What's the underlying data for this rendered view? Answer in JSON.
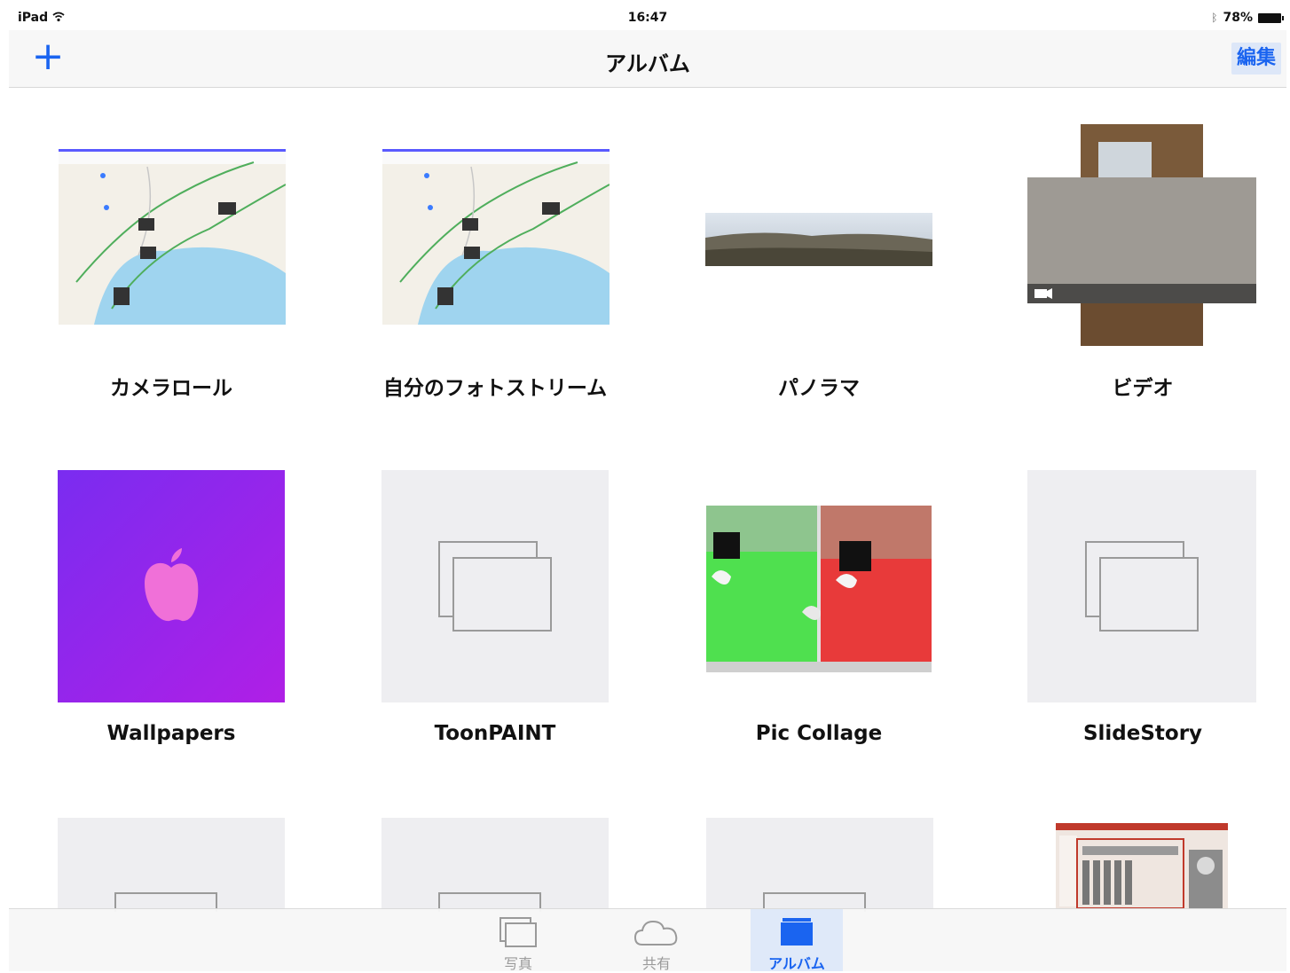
{
  "status": {
    "device": "iPad",
    "time": "16:47",
    "battery": "78%"
  },
  "nav": {
    "add_icon": "+",
    "title": "アルバム",
    "edit_label": "編集"
  },
  "albums": [
    {
      "title": "カメラロール"
    },
    {
      "title": "自分のフォトストリーム"
    },
    {
      "title": "パノラマ"
    },
    {
      "title": "ビデオ"
    },
    {
      "title": "Wallpapers"
    },
    {
      "title": "ToonPAINT"
    },
    {
      "title": "Pic Collage"
    },
    {
      "title": "SlideStory"
    }
  ],
  "tabs": [
    {
      "label": "写真",
      "icon": "photos-icon"
    },
    {
      "label": "共有",
      "icon": "cloud-icon"
    },
    {
      "label": "アルバム",
      "icon": "albums-icon"
    }
  ],
  "colors": {
    "accent": "#1a64f0",
    "wallpaper": "#8a2be2"
  }
}
